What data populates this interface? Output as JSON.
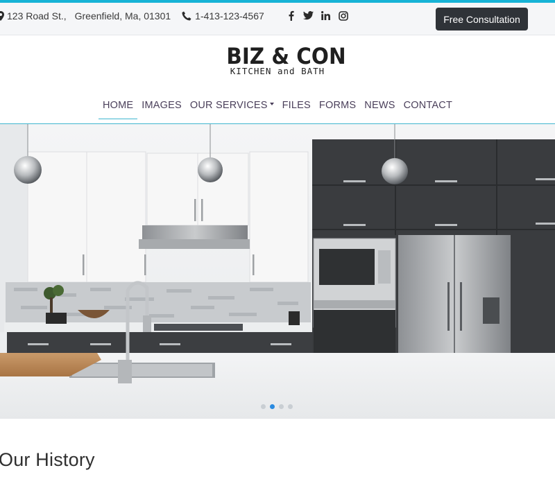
{
  "topbar": {
    "address_street": "123 Road St.,",
    "address_city": "Greenfield, Ma, 01301",
    "phone": "1-413-123-4567",
    "social": [
      "facebook-icon",
      "twitter-icon",
      "linkedin-icon",
      "instagram-icon"
    ],
    "cta_label": "Free Consultation"
  },
  "logo": {
    "line1": "BIZ & CON",
    "line2": "KITCHEN and BATH"
  },
  "nav": {
    "items": [
      {
        "label": "HOME",
        "active": true
      },
      {
        "label": "IMAGES"
      },
      {
        "label": "OUR SERVICES",
        "dropdown": true
      },
      {
        "label": "FILES"
      },
      {
        "label": "FORMS"
      },
      {
        "label": "NEWS"
      },
      {
        "label": "CONTACT"
      }
    ]
  },
  "carousel": {
    "slide_count": 4,
    "active_index": 1
  },
  "section": {
    "title": "Our History"
  },
  "colors": {
    "accent": "#17b3d6",
    "cta_bg": "#2f3338",
    "nav_text": "#4a3f5a",
    "active_dot": "#2a8ae0"
  }
}
